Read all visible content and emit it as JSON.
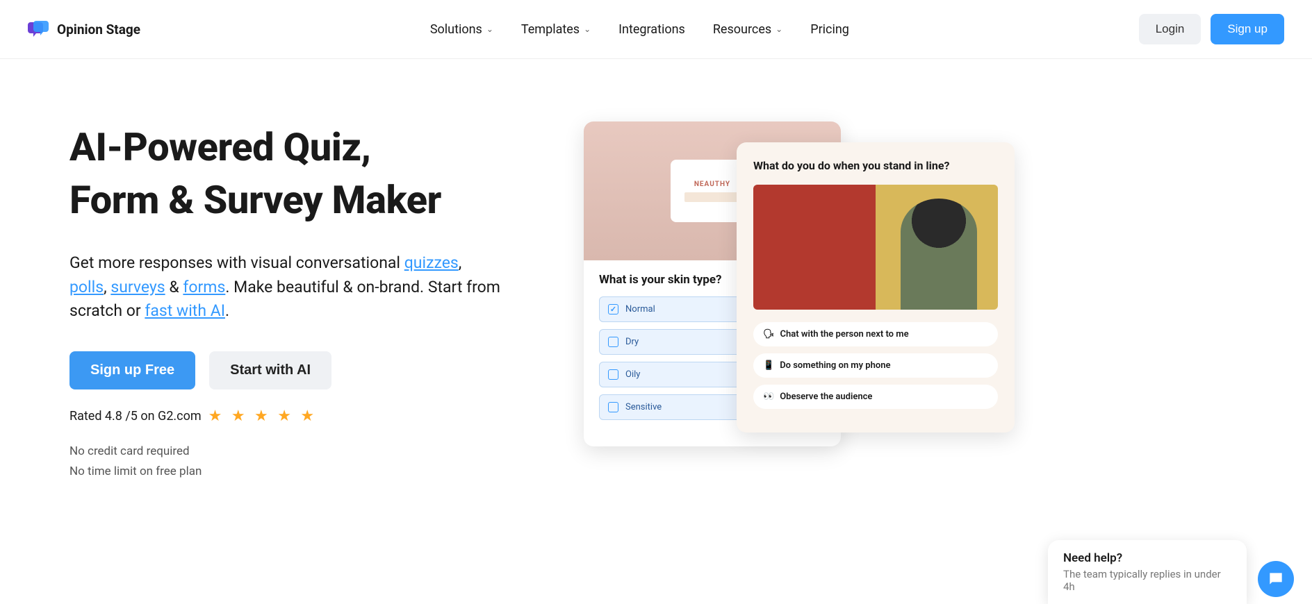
{
  "brand": {
    "name": "Opinion Stage"
  },
  "nav": {
    "solutions": "Solutions",
    "templates": "Templates",
    "integrations": "Integrations",
    "resources": "Resources",
    "pricing": "Pricing"
  },
  "auth": {
    "login": "Login",
    "signup": "Sign up"
  },
  "hero": {
    "line1": "AI-Powered Quiz,",
    "line2": "Form & Survey Maker",
    "sub_prefix": "Get more responses with visual conversational ",
    "link_quizzes": "quizzes",
    "sep1": ", ",
    "link_polls": "polls",
    "sep2": ", ",
    "link_surveys": "surveys",
    "sep3": " & ",
    "link_forms": "forms",
    "sub_mid": ". Make beautiful & on-brand. Start from scratch or ",
    "link_ai": "fast with AI",
    "sub_end": ".",
    "cta_signup": "Sign up Free",
    "cta_ai": "Start with AI",
    "rating_text": "Rated 4.8 /5 on G2.com",
    "note1": "No credit card required",
    "note2": "No time limit on free plan"
  },
  "card_skin": {
    "product": "NEAUTHY",
    "question": "What is your skin type?",
    "options": [
      "Normal",
      "Dry",
      "Oily",
      "Sensitive"
    ]
  },
  "card_line": {
    "question": "What do you do when you stand in line?",
    "answers": [
      {
        "icon": "🗣",
        "text": "Chat with the person next to me"
      },
      {
        "icon": "📱",
        "text": "Do something on my phone"
      },
      {
        "icon": "👀",
        "text": "Obeserve the audience"
      }
    ]
  },
  "chat": {
    "title": "Need help?",
    "sub": "The team typically replies in under 4h"
  }
}
